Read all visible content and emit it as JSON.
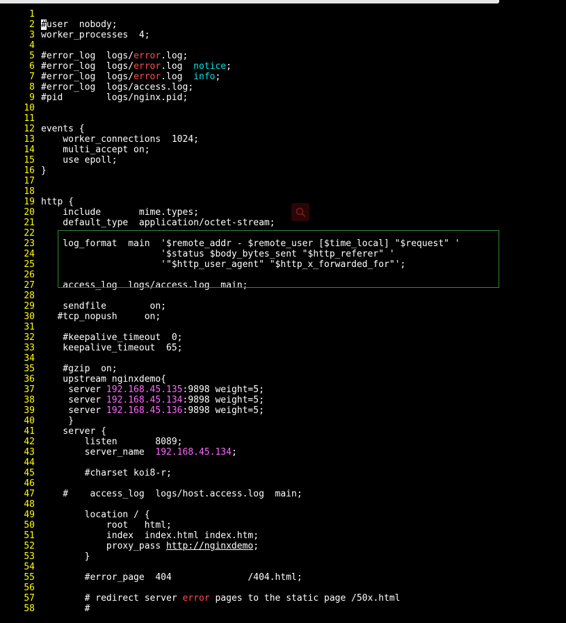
{
  "lines": [
    {
      "n": "1",
      "segs": []
    },
    {
      "n": "2",
      "segs": [
        {
          "t": "#",
          "c": "cursor"
        },
        {
          "t": "user  nobody;"
        }
      ]
    },
    {
      "n": "3",
      "segs": [
        {
          "t": "worker_processes  4;"
        }
      ]
    },
    {
      "n": "4",
      "segs": []
    },
    {
      "n": "5",
      "segs": [
        {
          "t": "#error_log  logs/"
        },
        {
          "t": "error",
          "c": "red"
        },
        {
          "t": ".log;"
        }
      ]
    },
    {
      "n": "6",
      "segs": [
        {
          "t": "#error_log  logs/"
        },
        {
          "t": "error",
          "c": "red"
        },
        {
          "t": ".log  "
        },
        {
          "t": "notice",
          "c": "cyan"
        },
        {
          "t": ";"
        }
      ]
    },
    {
      "n": "7",
      "segs": [
        {
          "t": "#error_log  logs/"
        },
        {
          "t": "error",
          "c": "red"
        },
        {
          "t": ".log  "
        },
        {
          "t": "info",
          "c": "cyan"
        },
        {
          "t": ";"
        }
      ]
    },
    {
      "n": "8",
      "segs": [
        {
          "t": "#error_log  logs/access.log;"
        }
      ]
    },
    {
      "n": "9",
      "segs": [
        {
          "t": "#pid        logs/nginx.pid;"
        }
      ]
    },
    {
      "n": "10",
      "segs": []
    },
    {
      "n": "11",
      "segs": []
    },
    {
      "n": "12",
      "segs": [
        {
          "t": "events {"
        }
      ]
    },
    {
      "n": "13",
      "segs": [
        {
          "t": "    worker_connections  1024;"
        }
      ]
    },
    {
      "n": "14",
      "segs": [
        {
          "t": "    multi_accept on;"
        }
      ]
    },
    {
      "n": "15",
      "segs": [
        {
          "t": "    use epoll;"
        }
      ]
    },
    {
      "n": "16",
      "segs": [
        {
          "t": "}"
        }
      ]
    },
    {
      "n": "17",
      "segs": []
    },
    {
      "n": "18",
      "segs": []
    },
    {
      "n": "19",
      "segs": [
        {
          "t": "http {"
        }
      ]
    },
    {
      "n": "20",
      "segs": [
        {
          "t": "    include       mime.types;"
        }
      ]
    },
    {
      "n": "21",
      "segs": [
        {
          "t": "    default_type  application/octet-stream;"
        }
      ]
    },
    {
      "n": "22",
      "segs": []
    },
    {
      "n": "23",
      "segs": [
        {
          "t": "    log_format  main  '$remote_addr - $remote_user [$time_local] \"$request\" '"
        }
      ]
    },
    {
      "n": "24",
      "segs": [
        {
          "t": "                      '$status $body_bytes_sent \"$http_referer\" '"
        }
      ]
    },
    {
      "n": "25",
      "segs": [
        {
          "t": "                      '\"$http_user_agent\" \"$http_x_forwarded_for\"';"
        }
      ]
    },
    {
      "n": "26",
      "segs": []
    },
    {
      "n": "27",
      "segs": [
        {
          "t": "    access_log  logs/access.log  main;"
        }
      ]
    },
    {
      "n": "28",
      "segs": []
    },
    {
      "n": "29",
      "segs": [
        {
          "t": "    sendfile        on;"
        }
      ]
    },
    {
      "n": "30",
      "segs": [
        {
          "t": "   #tcp_nopush     on;"
        }
      ]
    },
    {
      "n": "31",
      "segs": []
    },
    {
      "n": "32",
      "segs": [
        {
          "t": "    #keepalive_timeout  0;"
        }
      ]
    },
    {
      "n": "33",
      "segs": [
        {
          "t": "    keepalive_timeout  65;"
        }
      ]
    },
    {
      "n": "34",
      "segs": []
    },
    {
      "n": "35",
      "segs": [
        {
          "t": "    #gzip  on;"
        }
      ]
    },
    {
      "n": "36",
      "segs": [
        {
          "t": "    upstream nginxdemo{"
        }
      ]
    },
    {
      "n": "37",
      "segs": [
        {
          "t": "     server "
        },
        {
          "t": "192.168.45.135",
          "c": "mag"
        },
        {
          "t": ":9898 weight=5;"
        }
      ]
    },
    {
      "n": "38",
      "segs": [
        {
          "t": "     server "
        },
        {
          "t": "192.168.45.134",
          "c": "mag"
        },
        {
          "t": ":9898 weight=5;"
        }
      ]
    },
    {
      "n": "39",
      "segs": [
        {
          "t": "     server "
        },
        {
          "t": "192.168.45.136",
          "c": "mag"
        },
        {
          "t": ":9898 weight=5;"
        }
      ]
    },
    {
      "n": "40",
      "segs": [
        {
          "t": "     }"
        }
      ]
    },
    {
      "n": "41",
      "segs": [
        {
          "t": "    server {"
        }
      ]
    },
    {
      "n": "42",
      "segs": [
        {
          "t": "        listen       8089;"
        }
      ]
    },
    {
      "n": "43",
      "segs": [
        {
          "t": "        server_name  "
        },
        {
          "t": "192.168.45.134",
          "c": "mag"
        },
        {
          "t": ";"
        }
      ]
    },
    {
      "n": "44",
      "segs": []
    },
    {
      "n": "45",
      "segs": [
        {
          "t": "        #charset koi8-r;"
        }
      ]
    },
    {
      "n": "46",
      "segs": []
    },
    {
      "n": "47",
      "segs": [
        {
          "t": "    #    access_log  logs/host.access.log  main;"
        }
      ]
    },
    {
      "n": "48",
      "segs": []
    },
    {
      "n": "49",
      "segs": [
        {
          "t": "        location / {"
        }
      ]
    },
    {
      "n": "50",
      "segs": [
        {
          "t": "            root   html;"
        }
      ]
    },
    {
      "n": "51",
      "segs": [
        {
          "t": "            index  index.html index.htm;"
        }
      ]
    },
    {
      "n": "52",
      "segs": [
        {
          "t": "            proxy_pass "
        },
        {
          "t": "http://nginxdemo",
          "c": "ul"
        },
        {
          "t": ";"
        }
      ]
    },
    {
      "n": "53",
      "segs": [
        {
          "t": "        }"
        }
      ]
    },
    {
      "n": "54",
      "segs": []
    },
    {
      "n": "55",
      "segs": [
        {
          "t": "        #error_page  404              /404.html;"
        }
      ]
    },
    {
      "n": "56",
      "segs": []
    },
    {
      "n": "57",
      "segs": [
        {
          "t": "        # redirect server "
        },
        {
          "t": "error",
          "c": "red"
        },
        {
          "t": " pages to the static page /50x.html"
        }
      ]
    },
    {
      "n": "58",
      "segs": [
        {
          "t": "        #"
        }
      ]
    }
  ],
  "colors": {
    "background": "#000000",
    "line_number": "#ffff00",
    "text": "#ffffff",
    "keyword_red": "#ff4d4d",
    "keyword_cyan": "#00e5e5",
    "ip_magenta": "#ff66ff",
    "selection_border": "#2e8b2e"
  },
  "icons": {
    "search_overlay": "search-icon"
  }
}
